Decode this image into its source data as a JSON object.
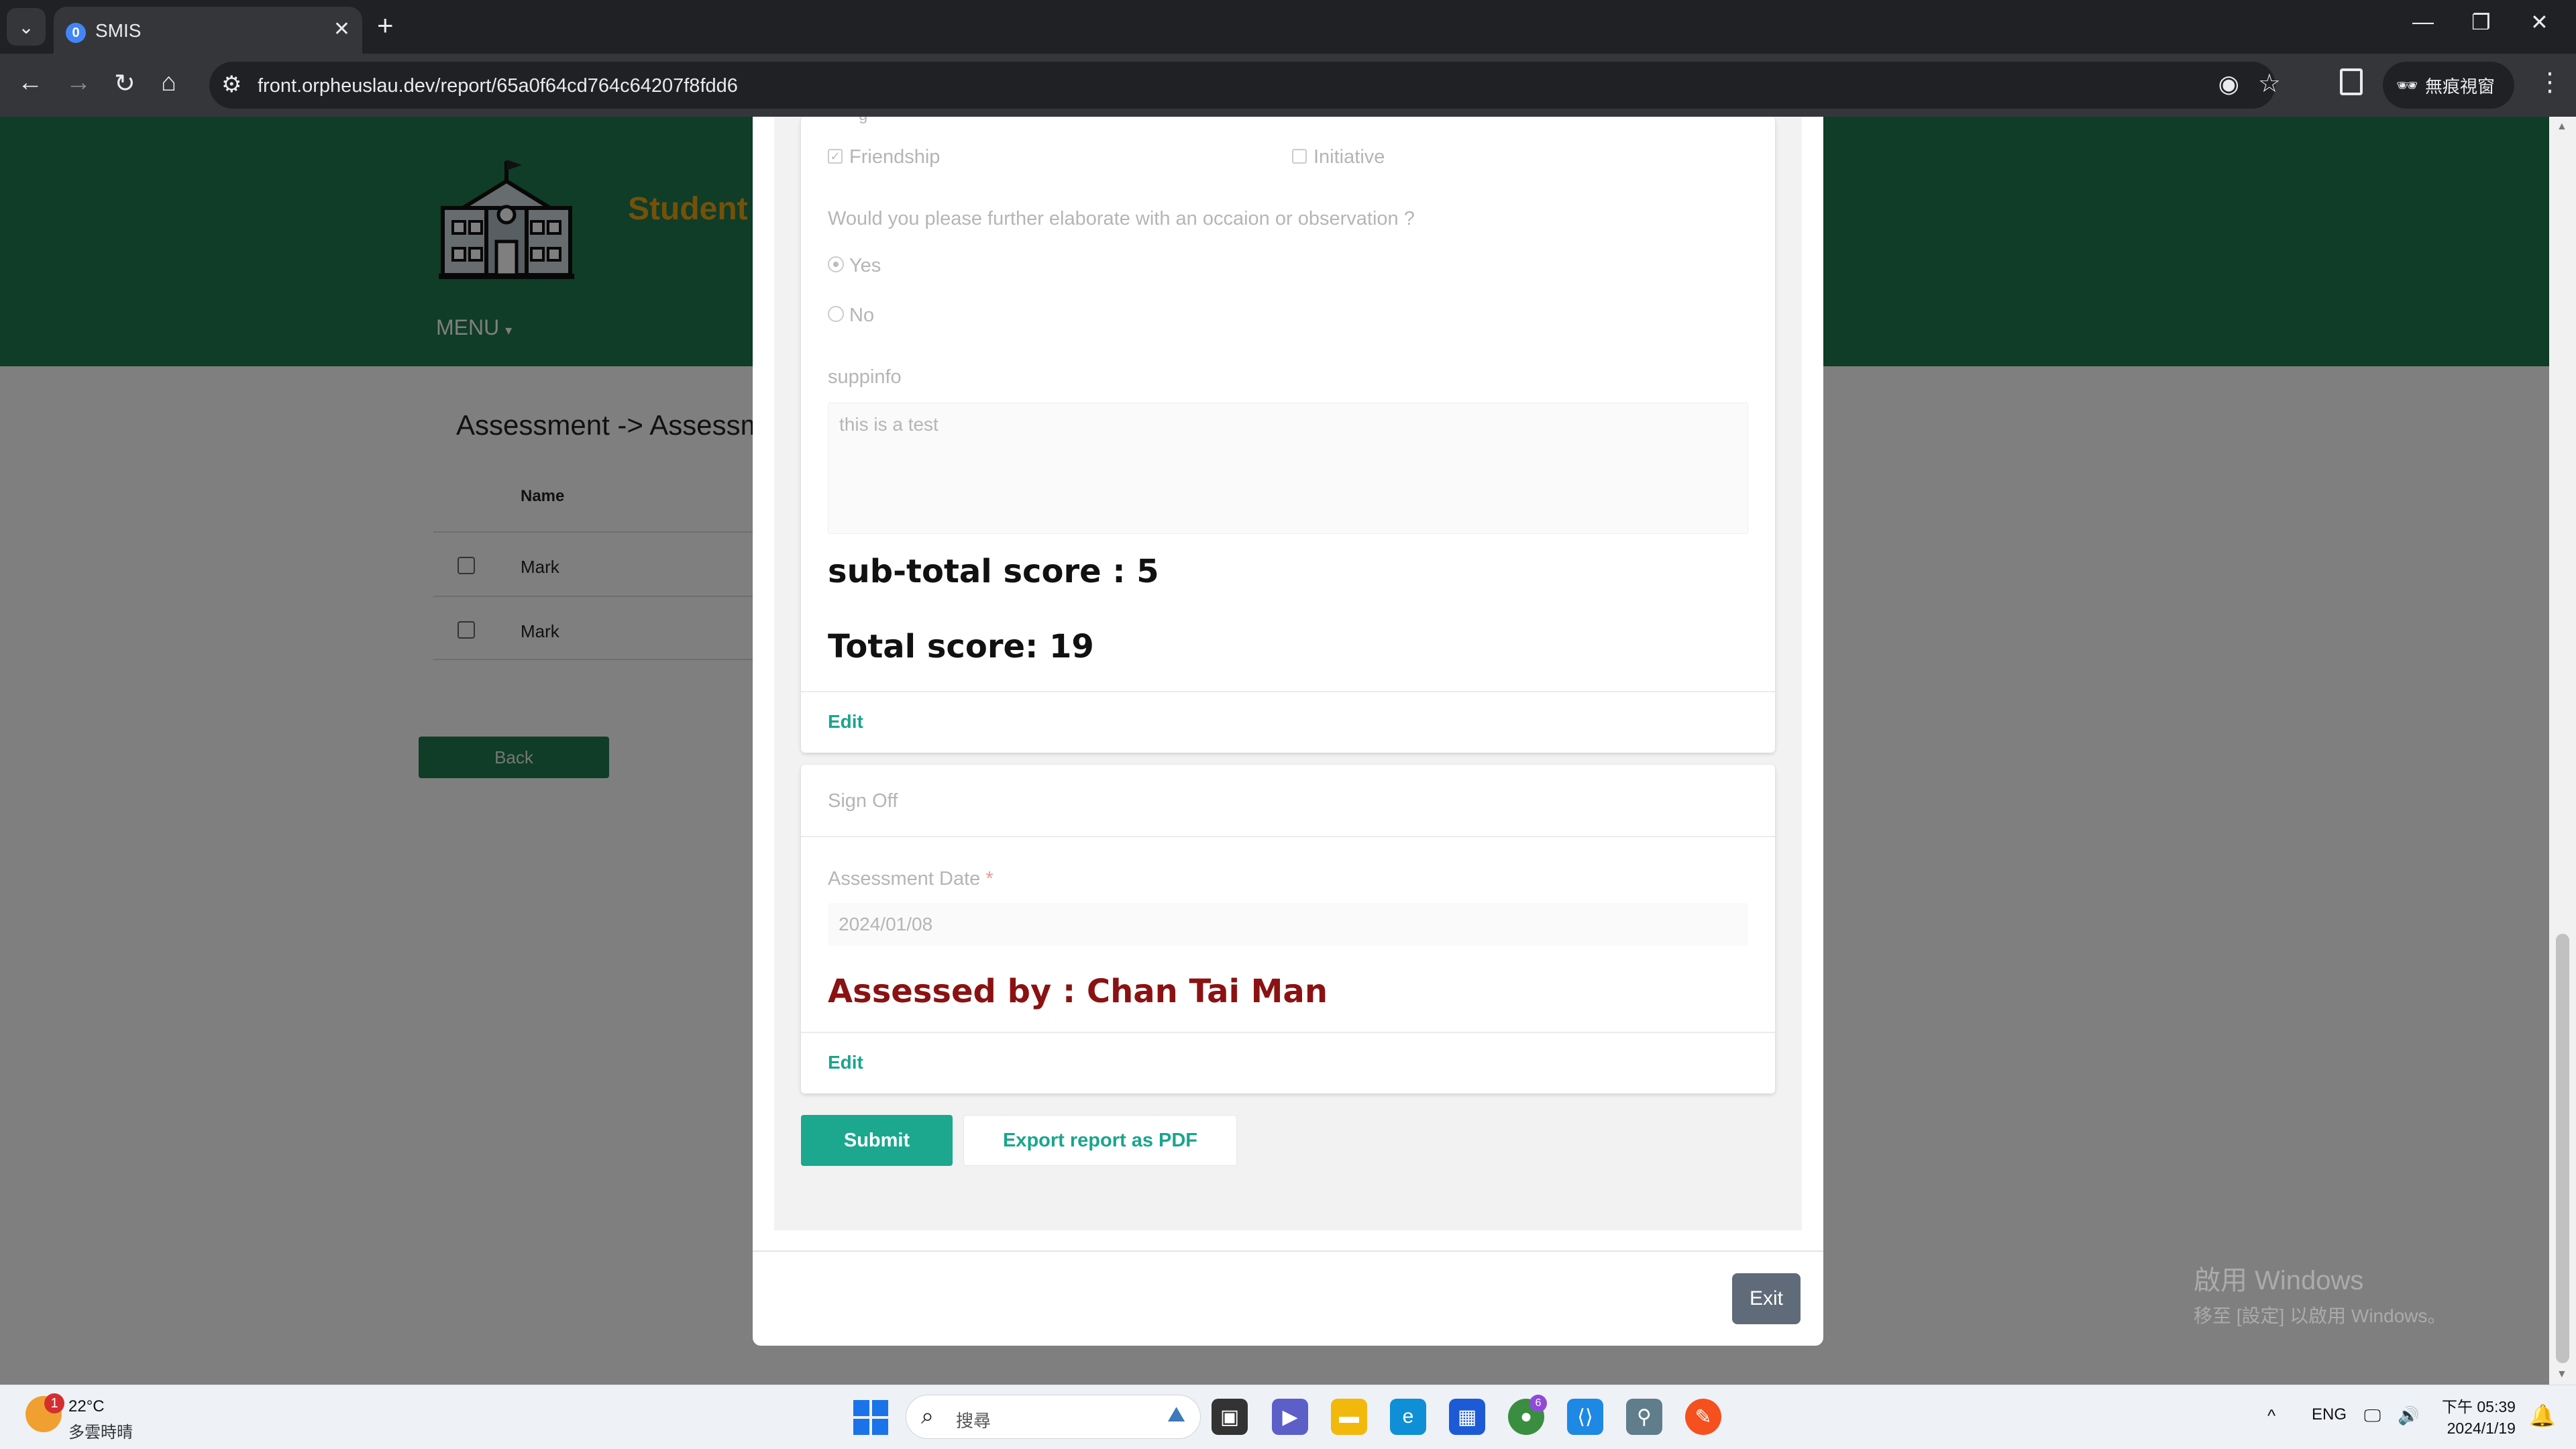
{
  "browser": {
    "tab_title": "SMIS",
    "tab_favicon": "0",
    "url": "front.orpheuslau.dev/report/65a0f64cd764c64207f8fdd6",
    "incognito_label": "無痕視窗"
  },
  "page": {
    "brand": "Student",
    "menu_label": "MENU",
    "breadcrumb": "Assessment -> Assessm",
    "table_header": "Name",
    "rows": [
      {
        "name": "Mark"
      },
      {
        "name": "Mark"
      }
    ],
    "back_label": "Back"
  },
  "modal": {
    "partial_label": "g",
    "checkboxes": [
      {
        "label": "Friendship",
        "checked": true
      },
      {
        "label": "Initiative",
        "checked": false
      }
    ],
    "question": "Would you please further elaborate with an occaion or observation ?",
    "radios": [
      {
        "label": "Yes",
        "selected": true
      },
      {
        "label": "No",
        "selected": false
      }
    ],
    "supp_label": "suppinfo",
    "supp_value": "this is a test",
    "subtotal": "sub-total score : 5",
    "total": "Total score: 19",
    "edit_label": "Edit",
    "signoff_title": "Sign Off",
    "date_label": "Assessment Date",
    "required_mark": "*",
    "date_value": "2024/01/08",
    "assessed_by": "Assessed by : Chan Tai Man",
    "edit2_label": "Edit",
    "submit_label": "Submit",
    "export_label": "Export report as PDF",
    "exit_label": "Exit"
  },
  "watermark": {
    "line1": "啟用 Windows",
    "line2": "移至 [設定] 以啟用 Windows。"
  },
  "taskbar": {
    "weather_badge": "1",
    "temperature": "22°C",
    "weather_desc": "多雲時晴",
    "search_placeholder": "搜尋",
    "chrome_badge": "6",
    "lang": "ENG",
    "time": "下午 05:39",
    "date": "2024/1/19"
  },
  "colors": {
    "brand_green": "#1e7b4f",
    "accent_teal": "#1ba88f",
    "assessed_red": "#8b1212",
    "brand_orange": "#e8a317"
  }
}
